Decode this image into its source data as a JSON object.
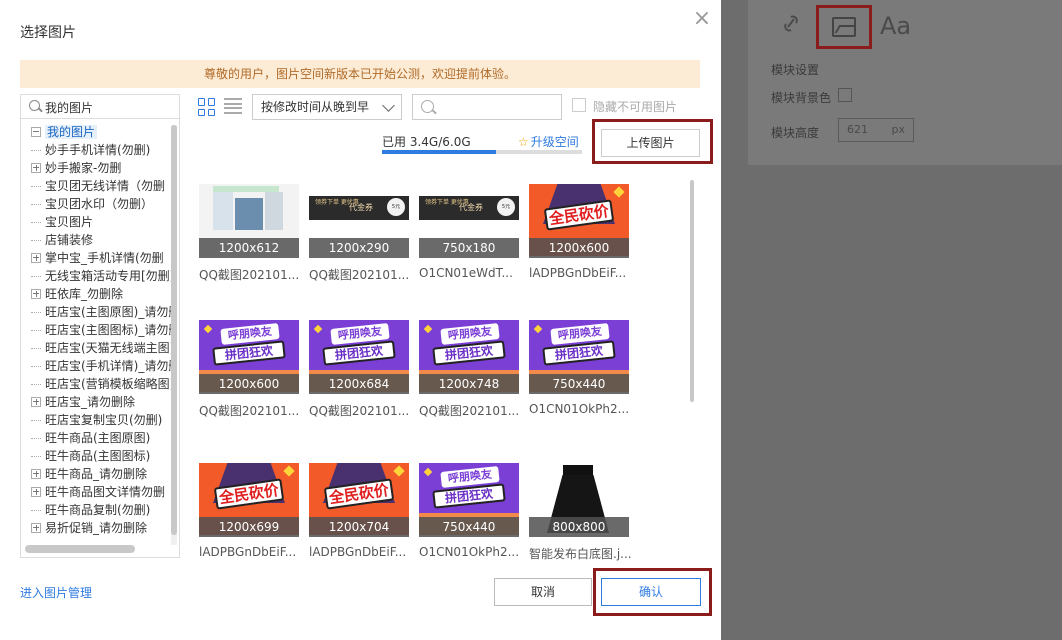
{
  "dialog": {
    "title": "选择图片",
    "close_icon": "close-icon",
    "notice": "尊敬的用户，图片空间新版本已开始公测，欢迎提前体验。"
  },
  "tree": {
    "search_value": "我的图片",
    "search_icon": "search-icon",
    "items": [
      {
        "label": "我的图片",
        "type": "root",
        "selected": true
      },
      {
        "label": "妙手手机详情(勿删)",
        "type": "leaf"
      },
      {
        "label": "妙手搬家-勿删",
        "type": "folder"
      },
      {
        "label": "宝贝团无线详情（勿删",
        "type": "leaf"
      },
      {
        "label": "宝贝团水印（勿删）",
        "type": "leaf"
      },
      {
        "label": "宝贝图片",
        "type": "leaf"
      },
      {
        "label": "店铺装修",
        "type": "leaf"
      },
      {
        "label": "掌中宝_手机详情(勿删",
        "type": "folder"
      },
      {
        "label": "无线宝箱活动专用[勿删]",
        "type": "leaf"
      },
      {
        "label": "旺依库_勿删除",
        "type": "folder"
      },
      {
        "label": "旺店宝(主图原图)_请勿删除",
        "type": "leaf"
      },
      {
        "label": "旺店宝(主图图标)_请勿删除",
        "type": "leaf"
      },
      {
        "label": "旺店宝(天猫无线端主图)",
        "type": "leaf"
      },
      {
        "label": "旺店宝(手机详情)_请勿删除",
        "type": "leaf"
      },
      {
        "label": "旺店宝(营销模板缩略图)",
        "type": "leaf"
      },
      {
        "label": "旺店宝_请勿删除",
        "type": "folder"
      },
      {
        "label": "旺店宝复制宝贝(勿删)",
        "type": "leaf"
      },
      {
        "label": "旺牛商品(主图原图)",
        "type": "leaf"
      },
      {
        "label": "旺牛商品(主图图标)",
        "type": "leaf"
      },
      {
        "label": "旺牛商品_请勿删除",
        "type": "folder"
      },
      {
        "label": "旺牛商品图文详情勿删",
        "type": "folder"
      },
      {
        "label": "旺牛商品复制(勿删)",
        "type": "leaf"
      },
      {
        "label": "易折促销_请勿删除",
        "type": "folder"
      }
    ]
  },
  "toolbar": {
    "grid_view_icon": "grid-view-icon",
    "list_view_icon": "list-view-icon",
    "sort_value": "按修改时间从晚到早",
    "search_icon": "search-icon",
    "search_value": "",
    "hide_unavailable_label": "隐藏不可用图片",
    "hide_unavailable_checked": false
  },
  "storage": {
    "used_text": "已用 3.4G/6.0G",
    "used_fraction": 0.57,
    "upgrade_label": "升级空间",
    "upgrade_icon": "star-icon"
  },
  "upload_label": "上传图片",
  "images": [
    {
      "size": "1200x612",
      "name": "QQ截图202101...",
      "kind": "qq"
    },
    {
      "size": "1200x290",
      "name": "QQ截图202101...",
      "kind": "coupon"
    },
    {
      "size": "750x180",
      "name": "O1CN01eWdT...",
      "kind": "coupon"
    },
    {
      "size": "1200x600",
      "name": "lADPBGnDbEiF...",
      "kind": "orange"
    },
    {
      "size": "1200x600",
      "name": "QQ截图202101...",
      "kind": "purple"
    },
    {
      "size": "1200x684",
      "name": "QQ截图202101...",
      "kind": "purple"
    },
    {
      "size": "1200x748",
      "name": "QQ截图202101...",
      "kind": "purple"
    },
    {
      "size": "750x440",
      "name": "O1CN01OkPh2...",
      "kind": "purple"
    },
    {
      "size": "1200x699",
      "name": "lADPBGnDbEiF...",
      "kind": "orange"
    },
    {
      "size": "1200x704",
      "name": "lADPBGnDbEiF...",
      "kind": "orange"
    },
    {
      "size": "750x440",
      "name": "O1CN01OkPh2...",
      "kind": "purple"
    },
    {
      "size": "800x800",
      "name": "智能发布白底图.j...",
      "kind": "skirt"
    }
  ],
  "picture_text": {
    "coupon_left": "领券下单\n更优惠",
    "coupon_mid": "代金券",
    "coupon_circle": "5元",
    "orange_badge": "全民砍价",
    "purple_line1": "呼朋唤友",
    "purple_line2": "拼团狂欢"
  },
  "footer": {
    "manage_link": "进入图片管理",
    "cancel_label": "取消",
    "confirm_label": "确认"
  },
  "background_panel": {
    "link_icon": "link-icon",
    "image_icon": "image-icon",
    "text_icon_label": "Aa",
    "module_settings": "模块设置",
    "module_bg_color": "模块背景色",
    "module_height": "模块高度",
    "height_value": "621",
    "height_unit": "px"
  },
  "colors": {
    "accent": "#2f7be0",
    "highlight_box": "#8a1c1c",
    "notice_bg": "#fdecd5",
    "notice_text": "#b06a28"
  }
}
